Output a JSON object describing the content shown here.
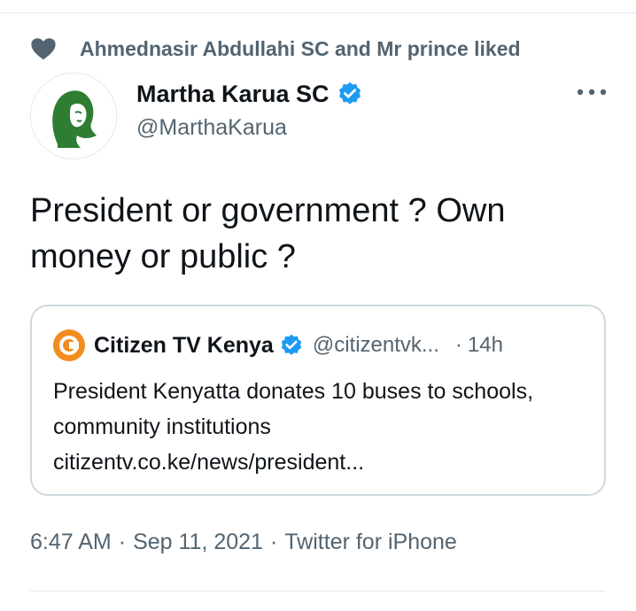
{
  "social_context": {
    "text": "Ahmednasir Abdullahi SC and Mr prince liked",
    "icon": "heart-icon"
  },
  "author": {
    "name": "Martha Karua SC",
    "handle": "@MarthaKarua",
    "verified": true
  },
  "tweet": {
    "text": "President or government ? Own money or public ?"
  },
  "quoted_tweet": {
    "author_name": "Citizen TV Kenya",
    "handle": "@citizentvk...",
    "separator": "·",
    "time": "14h",
    "text": "President Kenyatta donates 10 buses to schools, community institutions citizentv.co.ke/news/president..."
  },
  "meta": {
    "time": "6:47 AM",
    "date": "Sep 11, 2021",
    "source": "Twitter for iPhone",
    "separator": "·"
  },
  "colors": {
    "verified_blue": "#1d9bf0",
    "secondary_text": "#536471",
    "border": "#cfd9de",
    "avatar_green": "#2e7d32",
    "citizen_orange": "#f28c1e"
  }
}
